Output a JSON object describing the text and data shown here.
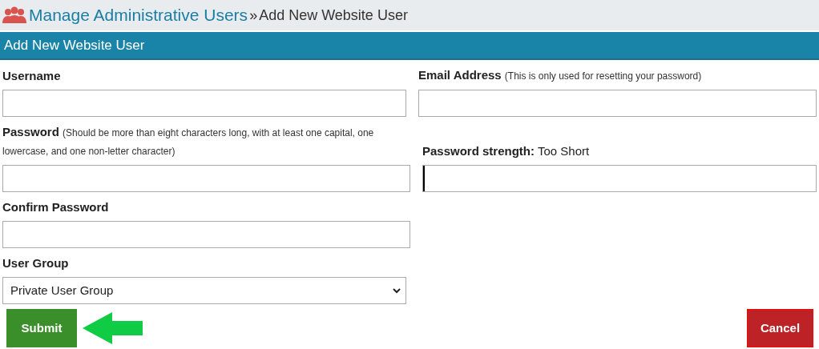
{
  "breadcrumb": {
    "link": "Manage Administrative Users",
    "separator": "»",
    "current": "Add New Website User"
  },
  "panel_title": "Add New Website User",
  "rows": [
    [
      {
        "kind": "text",
        "label": "Username"
      },
      {
        "kind": "text",
        "label": "Email Address",
        "hint": "(This is only used for resetting your password)"
      }
    ],
    [
      {
        "kind": "text",
        "label": "Password",
        "hint": "(Should be more than eight characters long, with at least one capital, one lowercase, and one non-letter character)"
      },
      {
        "kind": "meter",
        "label": "Password strength:",
        "reading": "Too Short",
        "level": 0.005
      }
    ],
    [
      {
        "kind": "text",
        "label": "Confirm Password"
      }
    ],
    [
      {
        "kind": "select",
        "label": "User Group",
        "value": "Private User Group"
      }
    ]
  ],
  "buttons": [
    {
      "kind": "submit",
      "label": "Submit"
    },
    {
      "kind": "cancel",
      "label": "Cancel"
    }
  ]
}
